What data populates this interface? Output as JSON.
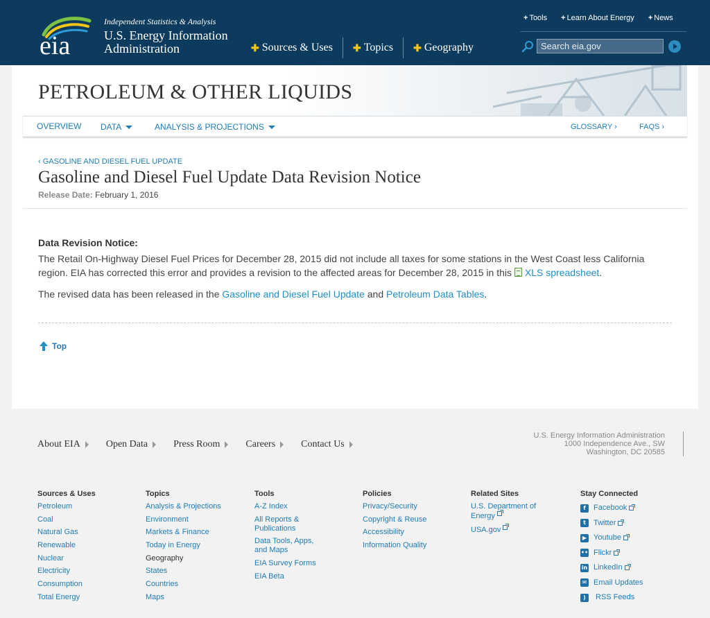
{
  "header": {
    "logo_text": "eia",
    "tagline": "Independent Statistics & Analysis",
    "agency_name": "U.S. Energy Information Administration",
    "main_nav": [
      "Sources & Uses",
      "Topics",
      "Geography"
    ],
    "util_nav": [
      "Tools",
      "Learn About Energy",
      "News"
    ],
    "search_placeholder": "Search eia.gov"
  },
  "banner": {
    "title": "PETROLEUM & OTHER LIQUIDS"
  },
  "sub_nav": {
    "overview": "OVERVIEW",
    "data": "DATA",
    "analysis": "ANALYSIS & PROJECTIONS",
    "glossary": "GLOSSARY ›",
    "faqs": "FAQS ›"
  },
  "article": {
    "breadcrumb": "‹ GASOLINE AND DIESEL FUEL UPDATE",
    "title": "Gasoline and Diesel Fuel Update Data Revision Notice",
    "release_label": "Release Date:",
    "release_date": "February 1, 2016",
    "notice_heading": "Data Revision Notice:",
    "notice_text": "The Retail On-Highway Diesel Fuel Prices for December 28, 2015 did not include all taxes for some stations in the West Coast less California region. EIA has corrected this error and provides a revision to the affected areas for December 28, 2015 in this",
    "xls_link": "XLS spreadsheet",
    "period": ".",
    "revised_prefix": "The revised data has been released in the",
    "revised_link1": "Gasoline and Diesel Fuel Update",
    "revised_and": "and",
    "revised_link2": "Petroleum Data Tables",
    "top_link": "Top"
  },
  "footer": {
    "links": [
      "About EIA",
      "Open Data",
      "Press Room",
      "Careers",
      "Contact Us"
    ],
    "address": [
      "U.S. Energy Information Administration",
      "1000 Independence Ave., SW",
      "Washington, DC 20585"
    ],
    "columns": {
      "sources": {
        "heading": "Sources & Uses",
        "items": [
          "Petroleum",
          "Coal",
          "Natural Gas",
          "Renewable",
          "Nuclear",
          "Electricity",
          "Consumption",
          "Total Energy"
        ]
      },
      "topics": {
        "heading": "Topics",
        "items": [
          "Analysis & Projections",
          "Environment",
          "Markets & Finance",
          "Today in Energy"
        ],
        "sub_heading": "Geography",
        "sub_items": [
          "States",
          "Countries",
          "Maps"
        ]
      },
      "tools": {
        "heading": "Tools",
        "items": [
          "A-Z Index",
          "All Reports & Publications",
          "Data Tools, Apps, and Maps",
          "EIA Survey Forms",
          "EIA Beta"
        ]
      },
      "policies": {
        "heading": "Policies",
        "items": [
          "Privacy/Security",
          "Copyright & Reuse",
          "Accessibility",
          "Information Quality"
        ]
      },
      "related": {
        "heading": "Related Sites",
        "items": [
          "U.S. Department of Energy",
          "USA.gov"
        ]
      },
      "stay": {
        "heading": "Stay Connected",
        "items": [
          "Facebook",
          "Twitter",
          "Youtube",
          "Flickr",
          "LinkedIn",
          "Email Updates",
          "RSS Feeds"
        ]
      }
    }
  }
}
